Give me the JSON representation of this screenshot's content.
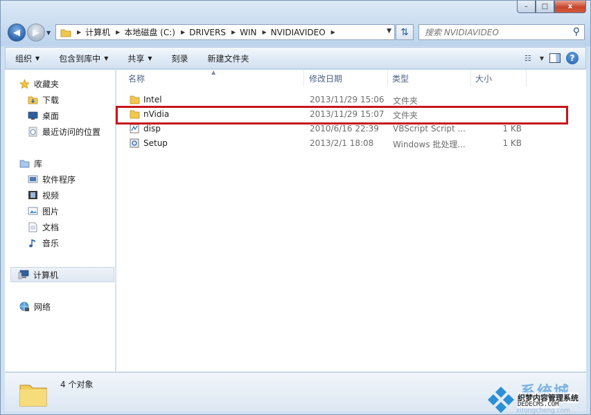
{
  "window": {
    "minimize": "–",
    "maximize": "□",
    "close": "x"
  },
  "address": {
    "crumbs": [
      "计算机",
      "本地磁盘 (C:)",
      "DRIVERS",
      "WIN",
      "NVIDIAVIDEO"
    ]
  },
  "search": {
    "placeholder": "搜索 NVIDIAVIDEO"
  },
  "toolbar": {
    "organize": "组织",
    "include_in_library": "包含到库中",
    "share": "共享",
    "burn": "刻录",
    "new_folder": "新建文件夹"
  },
  "sidebar": {
    "favorites": "收藏夹",
    "downloads": "下载",
    "desktop": "桌面",
    "recent": "最近访问的位置",
    "libraries": "库",
    "software": "软件程序",
    "videos": "视频",
    "pictures": "图片",
    "documents": "文档",
    "music": "音乐",
    "computer": "计算机",
    "network": "网络"
  },
  "columns": {
    "name": "名称",
    "modified": "修改日期",
    "type": "类型",
    "size": "大小"
  },
  "files": [
    {
      "name": "Intel",
      "modified": "2013/11/29 15:06",
      "type": "文件夹",
      "size": "",
      "icon": "folder-icon"
    },
    {
      "name": "nVidia",
      "modified": "2013/11/29 15:07",
      "type": "文件夹",
      "size": "",
      "icon": "folder-icon"
    },
    {
      "name": "disp",
      "modified": "2010/6/16 22:39",
      "type": "VBScript Script ...",
      "size": "1 KB",
      "icon": "vbscript-icon"
    },
    {
      "name": "Setup",
      "modified": "2013/2/1 18:08",
      "type": "Windows 批处理...",
      "size": "1 KB",
      "icon": "batch-file-icon"
    }
  ],
  "status": {
    "count": "4 个对象"
  },
  "watermark": {
    "brand": "系统城",
    "line1": "织梦内容管理系统",
    "line2": "DEDECMS.COM",
    "line3": "xitongcheng.com"
  },
  "colors": {
    "highlight_border": "#c8141c",
    "accent": "#2d65b0"
  }
}
